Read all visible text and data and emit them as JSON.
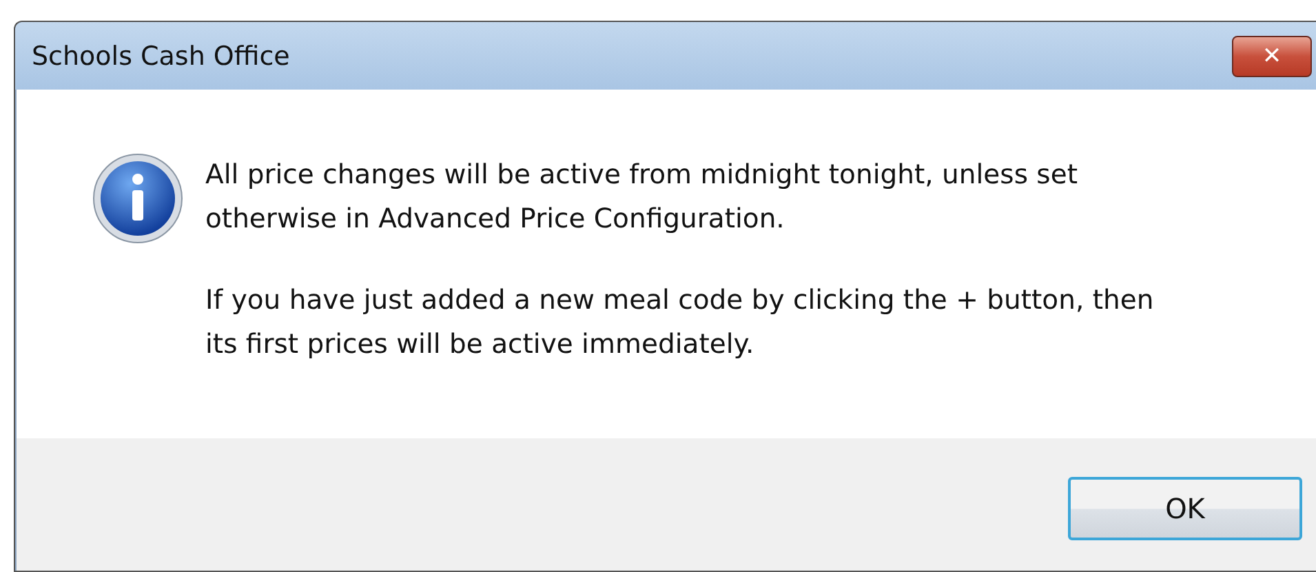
{
  "window": {
    "title": "Schools Cash Office",
    "close": "✕"
  },
  "message": {
    "paragraphs": [
      "All price changes will be active from midnight tonight, unless set otherwise in Advanced Price Configuration.",
      "If you have just added a new meal code by clicking the + button, then its first prices will be active immediately."
    ]
  },
  "buttons": [
    {
      "label": "OK",
      "default": true
    }
  ]
}
